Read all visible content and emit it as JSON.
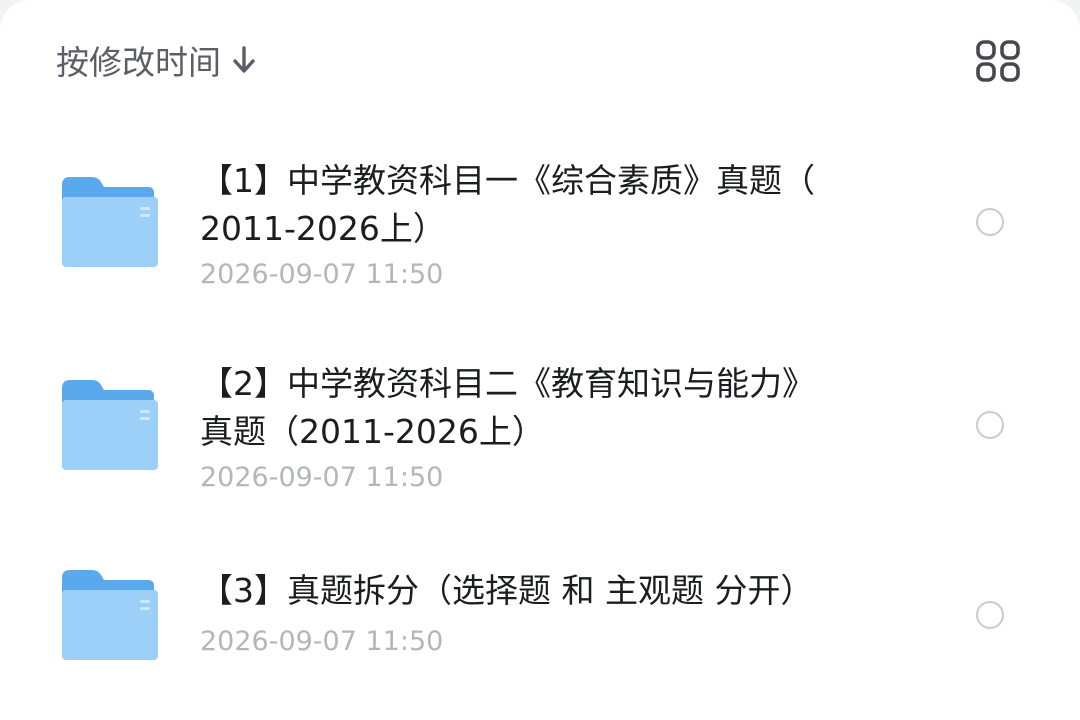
{
  "sort": {
    "label": "按修改时间",
    "arrow_icon": "arrow-down-icon"
  },
  "view_toggle": {
    "icon": "grid-view-icon"
  },
  "colors": {
    "folder_back": "#5aa9ec",
    "folder_front": "#9dd0f8",
    "title_text": "#1c1d20",
    "date_text": "#b3b6bc",
    "radio_border": "#c9cbcf"
  },
  "files": [
    {
      "icon": "folder-icon",
      "name_line1": "【1】中学教资科目一《综合素质》真题（",
      "name_line2": "2011-2026上）",
      "date": "2026-09-07 11:50",
      "selected": false
    },
    {
      "icon": "folder-icon",
      "name_line1": "【2】中学教资科目二《教育知识与能力》",
      "name_line2": "真题（2011-2026上）",
      "date": "2026-09-07 11:50",
      "selected": false
    },
    {
      "icon": "folder-icon",
      "name_line1": "【3】真题拆分（选择题 和 主观题 分开）",
      "date": "2026-09-07 11:50",
      "selected": false
    }
  ]
}
